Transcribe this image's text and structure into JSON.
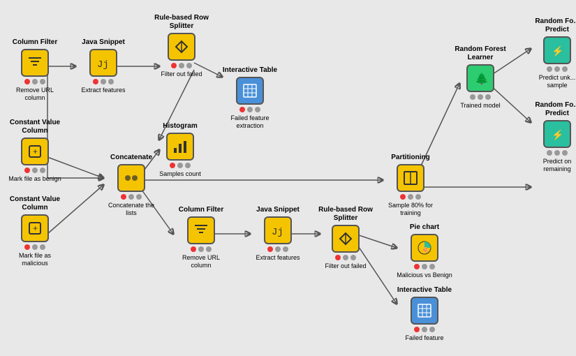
{
  "nodes": {
    "columnFilter": {
      "label": "Column Filter",
      "sublabel": "Remove URL\ncolumn"
    },
    "javaSnippetTop": {
      "label": "Java Snippet",
      "sublabel": "Extract\nfeatures"
    },
    "ruleSplitterTop": {
      "label": "Rule-based\nRow Splitter",
      "sublabel": "Filter out\nfailed"
    },
    "interactiveTableTop": {
      "label": "Interactive Table",
      "sublabel": "Failed feature\nextraction"
    },
    "histogram": {
      "label": "Histogram",
      "sublabel": "Samples count"
    },
    "constantValueBenign": {
      "label": "Constant\nValue Column",
      "sublabel": "Mark file as\nbenign"
    },
    "concatenate": {
      "label": "Concatenate",
      "sublabel": "Concatenate\nthe lists"
    },
    "constantValueMalicious": {
      "label": "Constant\nValue Column",
      "sublabel": "Mark file as\nmalicious"
    },
    "columnFilterBottom": {
      "label": "Column Filter",
      "sublabel": "Remove URL\ncolumn"
    },
    "javaSnippetBottom": {
      "label": "Java Snippet",
      "sublabel": "Extract\nfeatures"
    },
    "ruleSplitterBottom": {
      "label": "Rule-based\nRow Splitter",
      "sublabel": "Filter out\nfailed"
    },
    "partitioning": {
      "label": "Partitioning",
      "sublabel": "Sample 80%\nfor training"
    },
    "pieChart": {
      "label": "Pie chart",
      "sublabel": "Malicious vs\nBenign"
    },
    "interactiveTableBottom": {
      "label": "Interactive Table",
      "sublabel": "Failed feature"
    },
    "randomForestLearner": {
      "label": "Random Forest\nLearner",
      "sublabel": "Trained model"
    },
    "rfPredictorSample": {
      "label": "Random Fo...\nPredict",
      "sublabel": "Predict unk...\nsample"
    },
    "rfPredictorRemaining": {
      "label": "Random Fo...\nPredict",
      "sublabel": "Predict on\nremaining"
    }
  }
}
